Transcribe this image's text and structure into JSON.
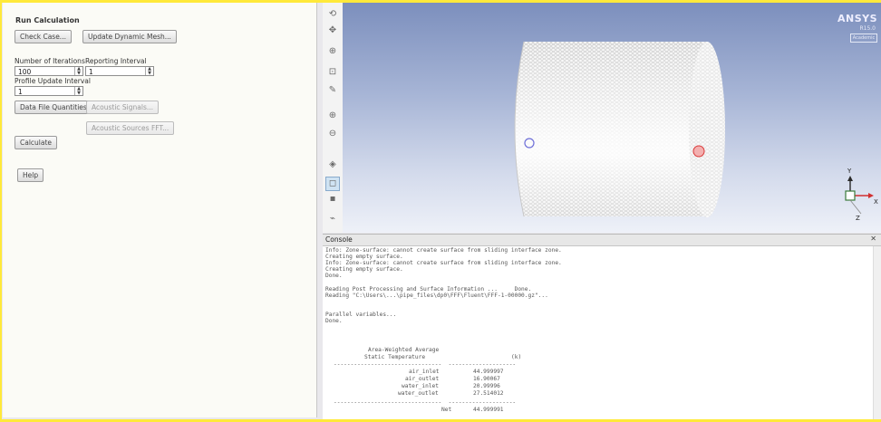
{
  "task_page": {
    "title": "Run Calculation",
    "check_case_label": "Check Case...",
    "update_mesh_label": "Update Dynamic Mesh...",
    "iterations_label": "Number of Iterations",
    "iterations_value": "100",
    "reporting_label": "Reporting Interval",
    "reporting_value": "1",
    "profile_label": "Profile Update Interval",
    "profile_value": "1",
    "data_file_label": "Data File Quantities...",
    "acoustic_signals_label": "Acoustic Signals...",
    "acoustic_fft_label": "Acoustic Sources FFT...",
    "calculate_label": "Calculate",
    "help_label": "Help"
  },
  "graphics": {
    "logo": "ANSYS",
    "logo_sub": "R15.0",
    "logo_badge": "Academic",
    "tools": [
      "rotate-icon",
      "pan-icon",
      "zoom-icon",
      "zoom-box-icon",
      "probe-icon",
      "zoom-in-icon",
      "zoom-out-icon",
      "fit-icon",
      "select-icon",
      "mesh-display-icon",
      "highlight-icon"
    ]
  },
  "axes": {
    "y": "Y",
    "x": "X",
    "z": "Z"
  },
  "console": {
    "title": "Console",
    "log": "Info: Zone-surface: cannot create surface from sliding interface zone.\nCreating empty surface.\nInfo: Zone-surface: cannot create surface from sliding interface zone.\nCreating empty surface.\nDone.\n\nReading Post Processing and Surface Information ...     Done.\nReading \"C:\\Users\\...\\pipe_files\\dp0\\FFF\\Fluent\\FFF-1-00000.gz\"...\n\n\nParallel variables...\nDone.\n",
    "report": {
      "title": "Area-Weighted Average",
      "quantity": "Static Temperature",
      "unit": "(k)",
      "separator": "--------------------------------  --------------------",
      "rows": [
        {
          "name": "air_inlet",
          "value": "44.999997"
        },
        {
          "name": "air_outlet",
          "value": "16.90067"
        },
        {
          "name": "water_inlet",
          "value": "20.99996"
        },
        {
          "name": "water_outlet",
          "value": "27.514012"
        }
      ],
      "net_label": "Net",
      "net_value": "44.999991"
    }
  },
  "colors": {
    "accent_yellow": "#ffe93a",
    "viewport_top": "#7c8fbd"
  }
}
